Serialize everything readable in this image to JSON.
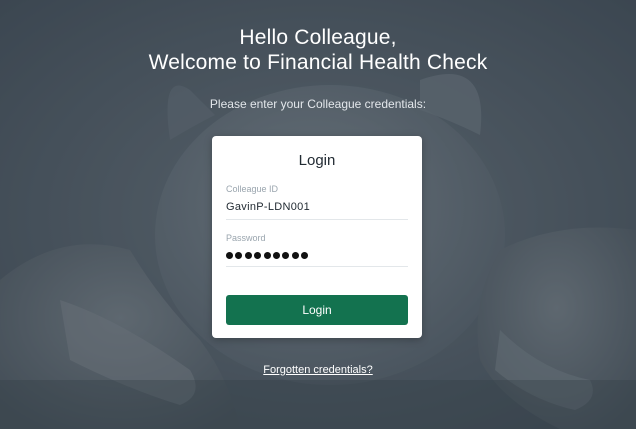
{
  "header": {
    "greeting": "Hello Colleague,",
    "welcome": "Welcome to Financial Health Check",
    "instructions": "Please enter your Colleague credentials:"
  },
  "login_card": {
    "title": "Login",
    "colleague_id_label": "Colleague ID",
    "colleague_id_value": "GavinP-LDN001",
    "password_label": "Password",
    "password_masked_length": 9,
    "submit_label": "Login"
  },
  "footer": {
    "forgot_link": "Forgotten credentials?"
  },
  "colors": {
    "primary_button": "#13724f",
    "overlay": "#3a444e",
    "text_on_dark": "#ffffff"
  },
  "background": {
    "icon": "piggy-bank-in-hands-photo"
  }
}
